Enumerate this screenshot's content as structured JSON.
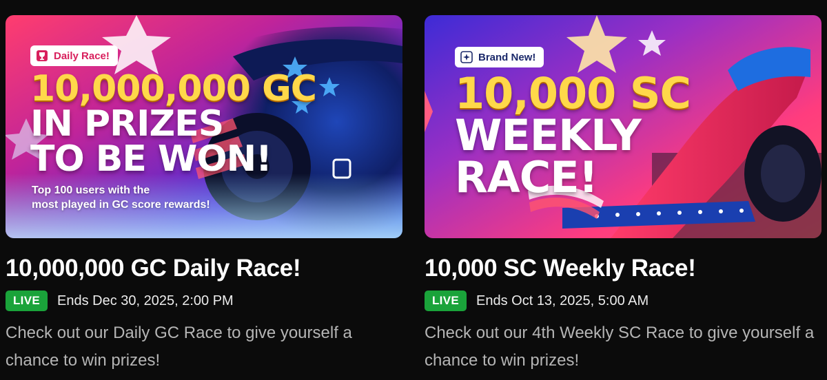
{
  "cards": [
    {
      "badge": "Daily Race!",
      "badge_icon": "trophy-icon",
      "headline_gold": "10,000,000 GC",
      "headline_white_1": "IN PRIZES",
      "headline_white_2": "TO BE WON!",
      "subtext_1": "Top 100 users with the",
      "subtext_2": "most played in GC score rewards!",
      "title": "10,000,000 GC Daily Race!",
      "status": "LIVE",
      "ends": "Ends Dec 30, 2025, 2:00 PM",
      "description": "Check out our Daily GC Race to give yourself a chance to win prizes!"
    },
    {
      "badge": "Brand New!",
      "badge_icon": "sparkle-icon",
      "headline_gold": "10,000 SC",
      "headline_white_1": "WEEKLY",
      "headline_white_2": "RACE!",
      "title": "10,000 SC Weekly Race!",
      "status": "LIVE",
      "ends": "Ends Oct 13, 2025, 5:00 AM",
      "description": "Check out our 4th Weekly SC Race to give yourself a chance to win prizes!"
    }
  ],
  "colors": {
    "background": "#0b0b0b",
    "live_badge": "#1aa33a",
    "headline_gold": "#ffd84a",
    "description_text": "#b5b5b5"
  }
}
